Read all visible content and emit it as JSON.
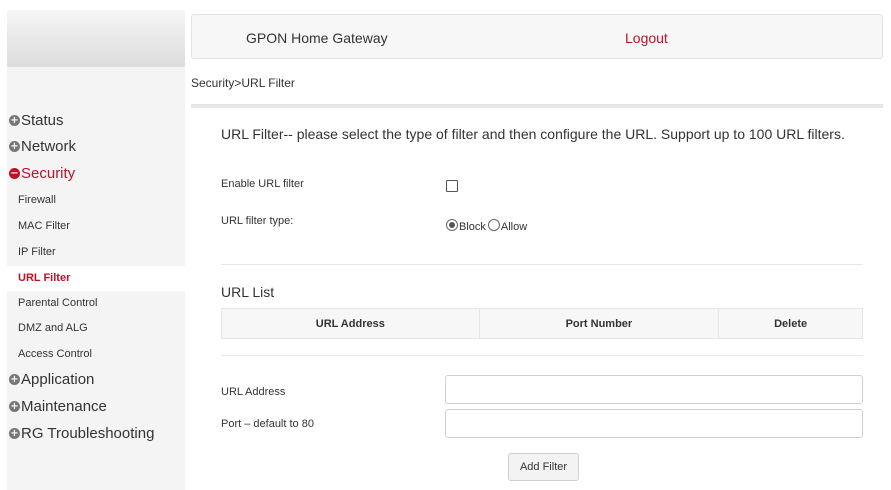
{
  "header": {
    "title": "GPON Home Gateway",
    "logout": "Logout"
  },
  "breadcrumb": "Security>URL Filter",
  "sidebar": {
    "top_items": [
      {
        "label": "Status",
        "icon": "plus"
      },
      {
        "label": "Network",
        "icon": "plus"
      },
      {
        "label": "Security",
        "icon": "minus",
        "active": true
      }
    ],
    "sub_items": [
      {
        "label": "Firewall"
      },
      {
        "label": "MAC Filter"
      },
      {
        "label": "IP Filter"
      },
      {
        "label": "URL Filter",
        "active": true
      },
      {
        "label": "Parental Control"
      },
      {
        "label": "DMZ and ALG"
      },
      {
        "label": "Access Control"
      }
    ],
    "bottom_items": [
      {
        "label": "Application",
        "icon": "plus"
      },
      {
        "label": "Maintenance",
        "icon": "plus"
      },
      {
        "label": "RG Troubleshooting",
        "icon": "plus"
      }
    ]
  },
  "main": {
    "description": "URL Filter-- please select the type of filter and then configure the URL. Support up to 100 URL filters.",
    "enable_label": "Enable URL filter",
    "enable_checked": false,
    "type_label": "URL filter type:",
    "type_options": [
      "Block",
      "Allow"
    ],
    "type_selected": "Block",
    "url_list_title": "URL List",
    "table_headers": [
      "URL Address",
      "Port Number",
      "Delete"
    ],
    "url_address_label": "URL Address",
    "url_address_value": "",
    "port_label": "Port – default to 80",
    "port_value": "",
    "add_button": "Add Filter"
  },
  "colors": {
    "accent": "#c0102a",
    "panel": "#f4f4f4"
  }
}
